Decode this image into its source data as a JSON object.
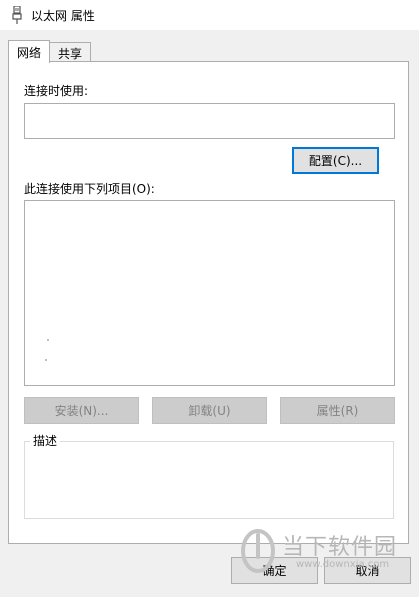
{
  "window": {
    "title": "以太网 属性"
  },
  "tabs": [
    {
      "label": "网络"
    },
    {
      "label": "共享"
    }
  ],
  "network_tab": {
    "connect_using_label": "连接时使用:",
    "connect_using_value": "",
    "configure_button": "配置(C)...",
    "items_label": "此连接使用下列项目(O):",
    "install_button": "安装(N)...",
    "uninstall_button": "卸载(U)",
    "properties_button": "属性(R)",
    "description_label": "描述",
    "description_text": ""
  },
  "footer": {
    "ok_button": "确定",
    "cancel_button": "取消"
  },
  "watermark": {
    "line1": "当下软件园",
    "line2": "www.downxia.com"
  },
  "colors": {
    "focus_border": "#0078d7",
    "disabled_text": "#838383"
  }
}
